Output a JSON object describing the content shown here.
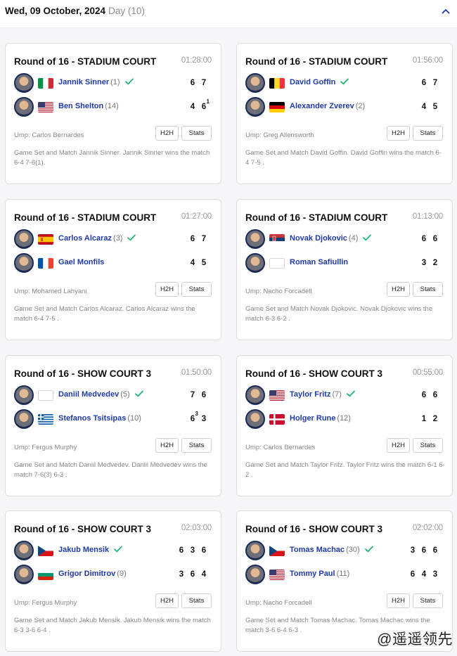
{
  "header": {
    "date": "Wed, 09 October, 2024",
    "day_label": "Day (10)",
    "collapse_icon": "chevron-up-icon"
  },
  "colors": {
    "accent": "#1f3aa8",
    "check": "#22b573",
    "avatar_ring": "#1a2a56"
  },
  "matches": [
    {
      "round": "Round of 16 - STADIUM COURT",
      "duration": "01:28:00",
      "players": [
        {
          "name": "Jannik Sinner",
          "seed": "(1)",
          "flag": "ITA",
          "winner": true,
          "scores": [
            "6",
            "7"
          ],
          "tb": [
            "",
            ""
          ]
        },
        {
          "name": "Ben Shelton",
          "seed": "(14)",
          "flag": "USA",
          "winner": false,
          "scores": [
            "4",
            "6"
          ],
          "tb": [
            "",
            "1"
          ]
        }
      ],
      "umpire": "Ump: Carlos Bernardes",
      "h2h": "H2H",
      "stats": "Stats",
      "summary": "Game Set and Match Jannik Sinner. Jannik Sinner wins the match 6-4 7-6(1)."
    },
    {
      "round": "Round of 16 - STADIUM COURT",
      "duration": "01:56:00",
      "players": [
        {
          "name": "David Goffin",
          "seed": "",
          "flag": "BEL",
          "winner": true,
          "scores": [
            "6",
            "7"
          ],
          "tb": [
            "",
            ""
          ]
        },
        {
          "name": "Alexander Zverev",
          "seed": "(2)",
          "flag": "GER",
          "winner": false,
          "scores": [
            "4",
            "5"
          ],
          "tb": [
            "",
            ""
          ]
        }
      ],
      "umpire": "Ump: Greg Allensworth",
      "h2h": "H2H",
      "stats": "Stats",
      "summary": "Game Set and Match David Goffin. David Goffin wins the match 6-4 7-5 ."
    },
    {
      "round": "Round of 16 - STADIUM COURT",
      "duration": "01:27:00",
      "players": [
        {
          "name": "Carlos Alcaraz",
          "seed": "(3)",
          "flag": "ESP",
          "winner": true,
          "scores": [
            "6",
            "7"
          ],
          "tb": [
            "",
            ""
          ]
        },
        {
          "name": "Gael Monfils",
          "seed": "",
          "flag": "FRA",
          "winner": false,
          "scores": [
            "4",
            "5"
          ],
          "tb": [
            "",
            ""
          ]
        }
      ],
      "umpire": "Ump: Mohamed Lahyani",
      "h2h": "H2H",
      "stats": "Stats",
      "summary": "Game Set and Match Carlos Alcaraz. Carlos Alcaraz wins the match 6-4 7-5 ."
    },
    {
      "round": "Round of 16 - STADIUM COURT",
      "duration": "01:13:00",
      "players": [
        {
          "name": "Novak Djokovic",
          "seed": "(4)",
          "flag": "SRB",
          "winner": true,
          "scores": [
            "6",
            "6"
          ],
          "tb": [
            "",
            ""
          ]
        },
        {
          "name": "Roman Safiullin",
          "seed": "",
          "flag": "NONE",
          "winner": false,
          "scores": [
            "3",
            "2"
          ],
          "tb": [
            "",
            ""
          ]
        }
      ],
      "umpire": "Ump: Nacho Forcadell",
      "h2h": "H2H",
      "stats": "Stats",
      "summary": "Game Set and Match Novak Djokovic. Novak Djokovic wins the match 6-3 6-2 ."
    },
    {
      "round": "Round of 16 - SHOW COURT 3",
      "duration": "01:50:00",
      "players": [
        {
          "name": "Daniil Medvedev",
          "seed": "(5)",
          "flag": "NONE",
          "winner": true,
          "scores": [
            "7",
            "6"
          ],
          "tb": [
            "",
            ""
          ]
        },
        {
          "name": "Stefanos Tsitsipas",
          "seed": "(10)",
          "flag": "GRE",
          "winner": false,
          "scores": [
            "6",
            "3"
          ],
          "tb": [
            "3",
            ""
          ]
        }
      ],
      "umpire": "Ump: Fergus Murphy",
      "h2h": "H2H",
      "stats": "Stats",
      "summary": "Game Set and Match Daniil Medvedev. Daniil Medvedev wins the match 7-6(3) 6-3 ."
    },
    {
      "round": "Round of 16 - SHOW COURT 3",
      "duration": "00:55:00",
      "players": [
        {
          "name": "Taylor Fritz",
          "seed": "(7)",
          "flag": "USA",
          "winner": true,
          "scores": [
            "6",
            "6"
          ],
          "tb": [
            "",
            ""
          ]
        },
        {
          "name": "Holger Rune",
          "seed": "(12)",
          "flag": "DEN",
          "winner": false,
          "scores": [
            "1",
            "2"
          ],
          "tb": [
            "",
            ""
          ]
        }
      ],
      "umpire": "Ump: Carlos Bernardes",
      "h2h": "H2H",
      "stats": "Stats",
      "summary": "Game Set and Match Taylor Fritz. Taylor Fritz wins the match 6-1 6-2 ."
    },
    {
      "round": "Round of 16 - SHOW COURT 3",
      "duration": "02:03:00",
      "players": [
        {
          "name": "Jakub Mensik",
          "seed": "",
          "flag": "CZE",
          "winner": true,
          "scores": [
            "6",
            "3",
            "6"
          ],
          "tb": [
            "",
            "",
            ""
          ]
        },
        {
          "name": "Grigor Dimitrov",
          "seed": "(9)",
          "flag": "BUL",
          "winner": false,
          "scores": [
            "3",
            "6",
            "4"
          ],
          "tb": [
            "",
            "",
            ""
          ]
        }
      ],
      "umpire": "Ump: Fergus Murphy",
      "h2h": "H2H",
      "stats": "Stats",
      "summary": "Game Set and Match Jakub Mensik. Jakub Mensik wins the match 6-3 3-6 6-4 ."
    },
    {
      "round": "Round of 16 - SHOW COURT 3",
      "duration": "02:02:00",
      "players": [
        {
          "name": "Tomas Machac",
          "seed": "(30)",
          "flag": "CZE",
          "winner": true,
          "scores": [
            "3",
            "6",
            "6"
          ],
          "tb": [
            "",
            "",
            ""
          ]
        },
        {
          "name": "Tommy Paul",
          "seed": "(11)",
          "flag": "USA",
          "winner": false,
          "scores": [
            "6",
            "4",
            "3"
          ],
          "tb": [
            "",
            "",
            ""
          ]
        }
      ],
      "umpire": "Ump: Nacho Forcadell",
      "h2h": "H2H",
      "stats": "Stats",
      "summary": "Game Set and Match Tomas Machac. Tomas Machac wins the match 3-6 6-4 6-3 ."
    }
  ],
  "watermark": "@遥遥领先"
}
